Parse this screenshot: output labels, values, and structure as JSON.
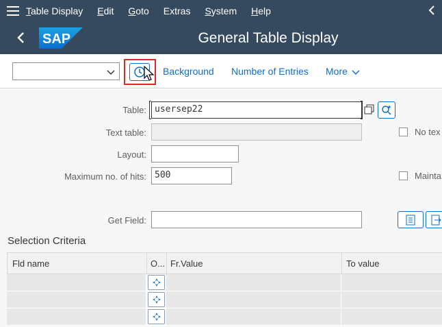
{
  "menu": {
    "items": [
      {
        "label": "Table Display",
        "u": "T",
        "rest": "able Display"
      },
      {
        "label": "Edit",
        "u": "E",
        "rest": "dit"
      },
      {
        "label": "Goto",
        "u": "G",
        "rest": "oto"
      },
      {
        "label": "Extras",
        "u": "",
        "rest": "Extras"
      },
      {
        "label": "System",
        "u": "S",
        "rest": "ystem"
      },
      {
        "label": "Help",
        "u": "H",
        "rest": "elp"
      }
    ]
  },
  "shell": {
    "title": "General Table Display",
    "logo": "SAP"
  },
  "toolbar": {
    "variant_value": "",
    "background_label": "Background",
    "entries_label": "Number of Entries",
    "more_label": "More"
  },
  "form": {
    "table_label": "Table:",
    "table_value": "usersep22",
    "text_table_label": "Text table:",
    "text_table_value": "",
    "layout_label": "Layout:",
    "layout_value": "",
    "max_hits_label": "Maximum no. of hits:",
    "max_hits_value": "500",
    "get_field_label": "Get Field:",
    "get_field_value": "",
    "no_text_label": "No tex",
    "maintain_label": "Mainta"
  },
  "selection": {
    "title": "Selection Criteria",
    "columns": [
      "Fld name",
      "O...",
      "Fr.Value",
      "To value"
    ],
    "row_count": 3
  },
  "colors": {
    "shell": "#354a5f",
    "link": "#0a6ed1",
    "highlight": "#e0291e"
  }
}
